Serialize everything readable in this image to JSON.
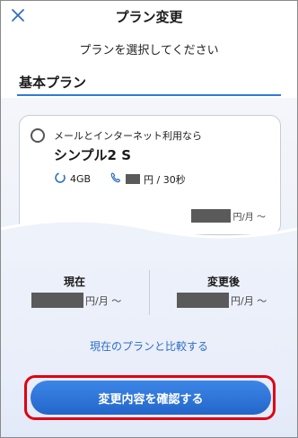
{
  "header": {
    "title": "プラン変更",
    "close_icon": "close-icon"
  },
  "subtitle": "プランを選択してください",
  "section": {
    "title": "基本プラン"
  },
  "plan": {
    "description": "メールとインターネット利用なら",
    "name": "シンプル2 S",
    "data_amount": "4GB",
    "call_suffix": "円 / 30秒",
    "price_suffix": "円/月 〜",
    "selected": false
  },
  "compare": {
    "current_label": "現在",
    "current_price_suffix": "円/月 〜",
    "after_label": "変更後",
    "after_price_suffix": "円/月 〜"
  },
  "compare_link": "現在のプランと比較する",
  "confirm_button": "変更内容を確認する",
  "colors": {
    "accent": "#2f7ad6",
    "button": "#2466c9",
    "highlight_border": "#e00012",
    "link": "#2f6fc4"
  }
}
